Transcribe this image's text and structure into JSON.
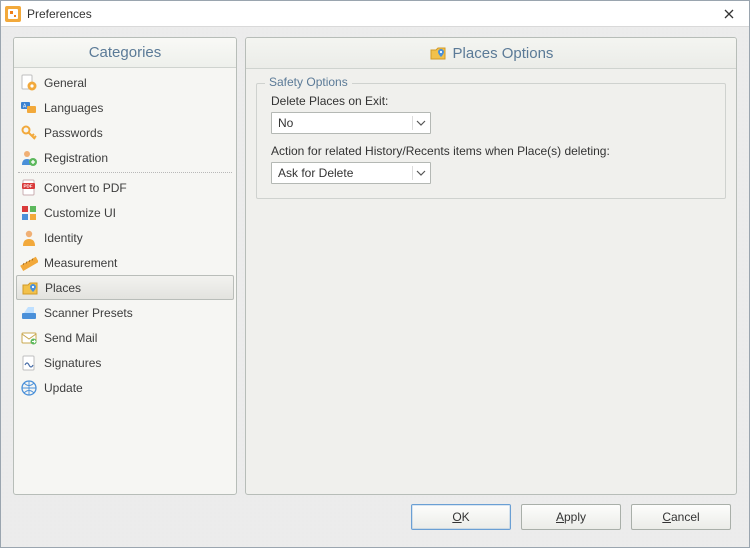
{
  "window": {
    "title": "Preferences"
  },
  "sidebar": {
    "header": "Categories",
    "items": [
      {
        "label": "General",
        "icon": "gear-doc-icon"
      },
      {
        "label": "Languages",
        "icon": "languages-icon"
      },
      {
        "label": "Passwords",
        "icon": "key-icon"
      },
      {
        "label": "Registration",
        "icon": "user-add-icon"
      }
    ],
    "items2": [
      {
        "label": "Convert to PDF",
        "icon": "pdf-icon"
      },
      {
        "label": "Customize UI",
        "icon": "squares-icon"
      },
      {
        "label": "Identity",
        "icon": "identity-icon"
      },
      {
        "label": "Measurement",
        "icon": "ruler-icon"
      },
      {
        "label": "Places",
        "icon": "places-icon",
        "selected": true
      },
      {
        "label": "Scanner Presets",
        "icon": "scanner-icon"
      },
      {
        "label": "Send Mail",
        "icon": "mail-icon"
      },
      {
        "label": "Signatures",
        "icon": "signature-icon"
      },
      {
        "label": "Update",
        "icon": "globe-icon"
      }
    ]
  },
  "options": {
    "header": "Places Options",
    "fieldset_legend": "Safety Options",
    "delete_on_exit": {
      "label": "Delete Places on Exit:",
      "value": "No"
    },
    "action_related": {
      "label": "Action for related History/Recents items when Place(s) deleting:",
      "value": "Ask for Delete"
    }
  },
  "buttons": {
    "ok": "OK",
    "apply": "Apply",
    "cancel": "Cancel"
  },
  "colors": {
    "accent_blue": "#5b7a97",
    "panel_border": "#b7bdb8"
  }
}
